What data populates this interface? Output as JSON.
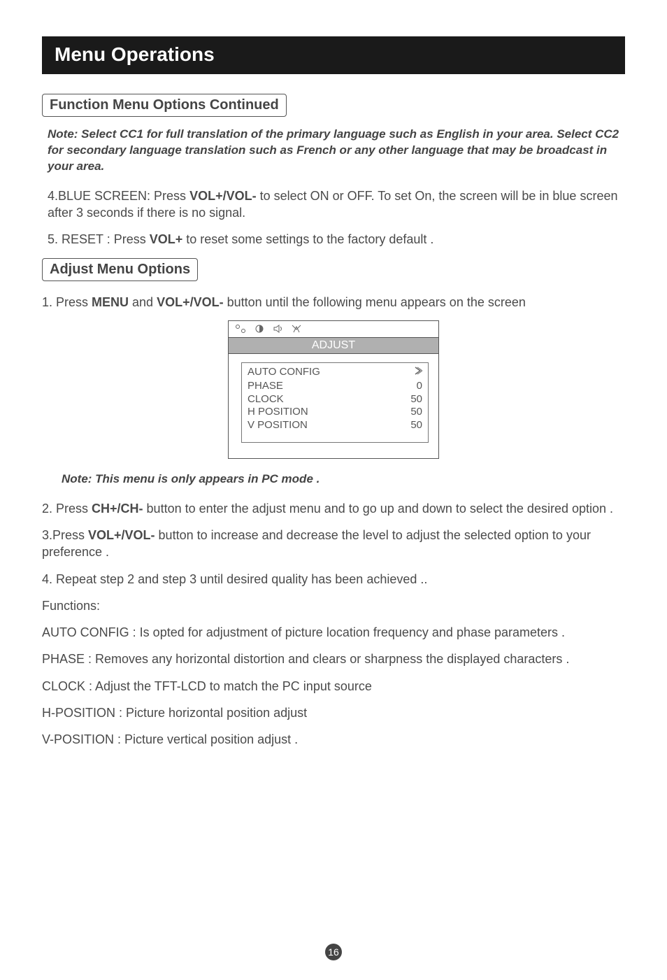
{
  "title": "Menu Operations",
  "section1": "Function Menu Options Continued",
  "note1": "Note: Select CC1 for full translation of the primary language such as English in your area. Select CC2 for secondary language translation such as French  or any other language that may be broadcast in your area.",
  "p4_prefix": "4.BLUE SCREEN: Press ",
  "vol": "VOL+/VOL-",
  "p4_suffix": " to select ON or OFF. To set On, the screen will be in blue screen after 3 seconds if there is no signal.",
  "p5_prefix": "5.  RESET : Press ",
  "volp": "VOL+",
  "p5_suffix": " to reset some settings to the factory default .",
  "section2": "Adjust  Menu Options",
  "s2_1a": "1. Press ",
  "menu": "MENU",
  "s2_1b": " and ",
  "s2_1c": " button until the following menu appears on the screen",
  "osd": {
    "head": "ADJUST",
    "rows": [
      {
        "label": "AUTO CONFIG",
        "val": ""
      },
      {
        "label": "PHASE",
        "val": "0"
      },
      {
        "label": "CLOCK",
        "val": "50"
      },
      {
        "label": "H POSITION",
        "val": "50"
      },
      {
        "label": "V POSITION",
        "val": "50"
      }
    ]
  },
  "note2": "Note: This menu is only appears in PC mode .",
  "s2_2a": "2. Press ",
  "ch": "CH+/CH-",
  "s2_2b": " button to enter the adjust menu and to go up and down to select the desired option .",
  "s2_3a": "3.Press ",
  "s2_3b": " button to increase and decrease the level to adjust the selected option to your preference .",
  "s2_4": "4. Repeat step 2 and step 3 until desired quality has been achieved ..",
  "fn_head": "Functions:",
  "fn1": "AUTO CONFIG : Is opted for adjustment of picture location frequency and phase parameters .",
  "fn2": "PHASE : Removes any horizontal distortion and clears or sharpness the displayed characters .",
  "fn3": "CLOCK : Adjust the TFT-LCD to match the PC input source",
  "fn4": "H-POSITION : Picture horizontal position adjust",
  "fn5": "V-POSITION : Picture vertical position adjust .",
  "page": "16"
}
